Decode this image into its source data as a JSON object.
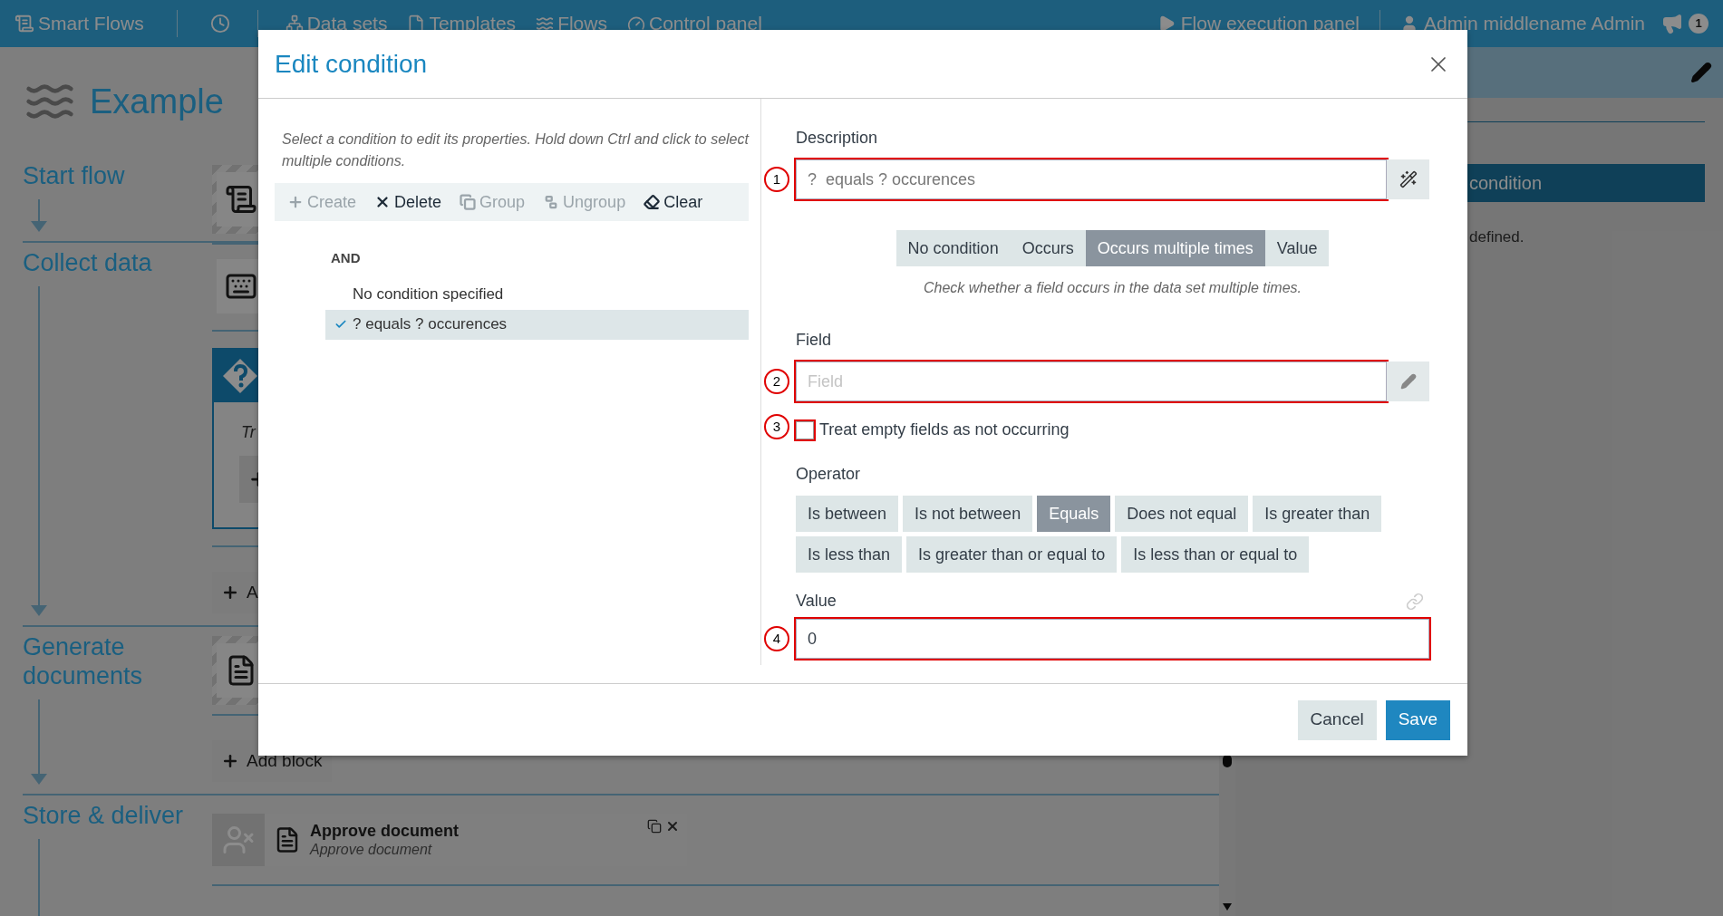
{
  "nav": {
    "brand": "Smart Flows",
    "items": [
      {
        "label": "Data sets"
      },
      {
        "label": "Templates"
      },
      {
        "label": "Flows"
      },
      {
        "label": "Control panel"
      }
    ],
    "right_items": [
      {
        "label": "Flow execution panel"
      },
      {
        "label": "Admin middlename Admin"
      }
    ],
    "notification_count": "1"
  },
  "flow": {
    "title": "Example",
    "stages": [
      {
        "label": "Start flow",
        "blocks": [
          {
            "kind": "start",
            "hatched": true
          }
        ]
      },
      {
        "label": "Collect data",
        "blocks": [
          {
            "kind": "input",
            "hatched": false
          },
          {
            "kind": "condition",
            "text": "Tr"
          },
          {
            "kind": "add",
            "label": "A"
          }
        ]
      },
      {
        "label": "Generate documents",
        "blocks": [
          {
            "kind": "document",
            "hatched": true
          },
          {
            "kind": "add",
            "label": "Add block"
          }
        ]
      },
      {
        "label": "Store & deliver",
        "blocks": [
          {
            "kind": "task",
            "title": "Approve document",
            "subtitle": "Approve document"
          }
        ]
      }
    ]
  },
  "side_panel": {
    "button": "condition",
    "text": "defined."
  },
  "dialog": {
    "title": "Edit condition",
    "hint": "Select a condition to edit its properties. Hold down Ctrl and click to select multiple conditions.",
    "toolbar": [
      {
        "label": "Create",
        "disabled": true
      },
      {
        "label": "Delete",
        "disabled": false
      },
      {
        "label": "Group",
        "disabled": true
      },
      {
        "label": "Ungroup",
        "disabled": true
      },
      {
        "label": "Clear",
        "disabled": false
      }
    ],
    "tree": {
      "operator": "AND",
      "items": [
        {
          "label": "No condition specified",
          "selected": false
        },
        {
          "label": "? equals ? occurences",
          "selected": true
        }
      ]
    },
    "description": {
      "label": "Description",
      "placeholder": "?  equals ? occurences",
      "annotation": "1"
    },
    "condition_types": [
      {
        "label": "No condition",
        "selected": false
      },
      {
        "label": "Occurs",
        "selected": false
      },
      {
        "label": "Occurs multiple times",
        "selected": true
      },
      {
        "label": "Value",
        "selected": false
      }
    ],
    "type_hint": "Check whether a field occurs in the data set multiple times.",
    "field": {
      "label": "Field",
      "placeholder": "Field",
      "annotation": "2"
    },
    "checkbox": {
      "label": "Treat empty fields as not occurring",
      "checked": false,
      "annotation": "3"
    },
    "operator": {
      "label": "Operator",
      "options": [
        {
          "label": "Is between",
          "selected": false
        },
        {
          "label": "Is not between",
          "selected": false
        },
        {
          "label": "Equals",
          "selected": true
        },
        {
          "label": "Does not equal",
          "selected": false
        },
        {
          "label": "Is greater than",
          "selected": false
        },
        {
          "label": "Is less than",
          "selected": false
        },
        {
          "label": "Is greater than or equal to",
          "selected": false
        },
        {
          "label": "Is less than or equal to",
          "selected": false
        }
      ]
    },
    "value": {
      "label": "Value",
      "value": "0",
      "annotation": "4"
    },
    "buttons": [
      {
        "label": "Cancel",
        "kind": "secondary"
      },
      {
        "label": "Save",
        "kind": "primary"
      }
    ]
  }
}
